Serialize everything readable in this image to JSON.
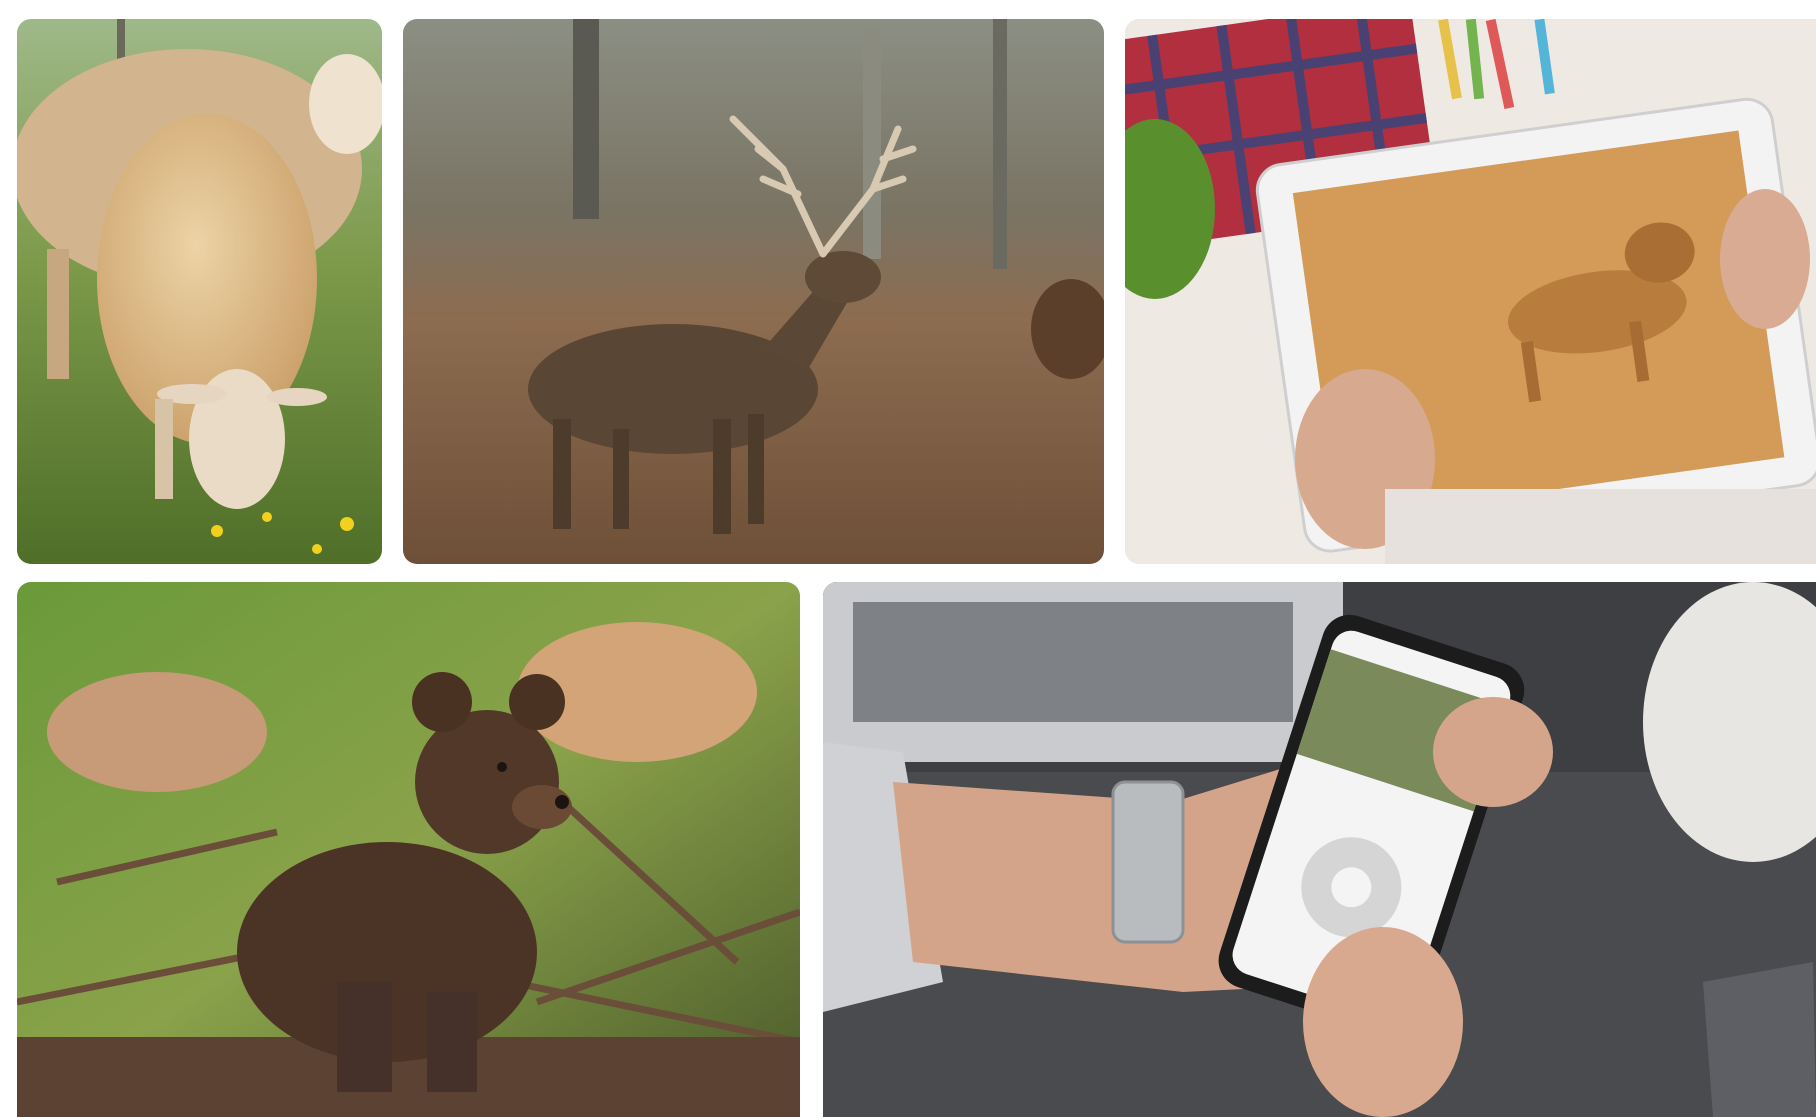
{
  "gallery": {
    "tiles": [
      {
        "subject": "sheep-grazing"
      },
      {
        "subject": "red-deer-stag"
      },
      {
        "subject": "tablet-lion-video"
      },
      {
        "subject": "brown-bear-cub"
      },
      {
        "subject": "phone-camera-app"
      }
    ]
  },
  "colors": {
    "background": "#ffffff",
    "grass": "#6f8f3a",
    "sheep_wool": "#d9b98a",
    "deer_fur": "#5a4634",
    "bracken": "#8a6a4a",
    "desk_wood": "#e8e0d8",
    "tablet_frame": "#f3f3f3",
    "lion_sand": "#d39a58",
    "bear_fur": "#4b3426",
    "phone_dark": "#1c1c1c",
    "sofa_gray": "#3e3f42"
  }
}
